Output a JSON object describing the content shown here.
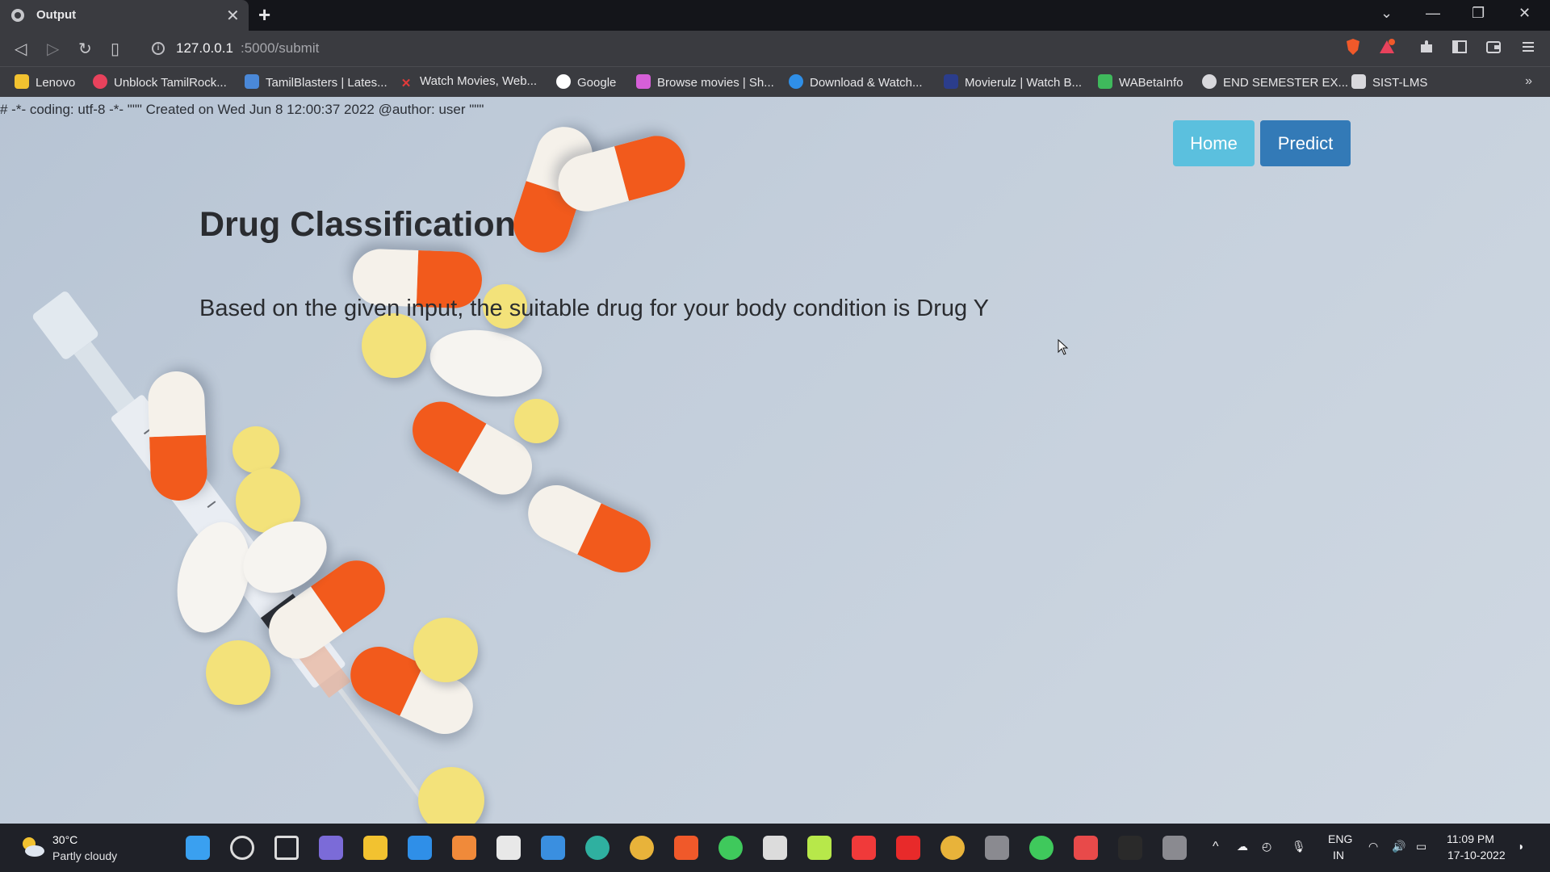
{
  "browser": {
    "tab_title": "Output",
    "tab_close": "✕",
    "new_tab": "+",
    "url_host": "127.0.0.1",
    "url_path": ":5000/submit",
    "window_controls": [
      "⌄",
      "—",
      "❐",
      "✕"
    ],
    "bookmarks": [
      {
        "label": "Lenovo",
        "icon": "folder-icon",
        "color": "#f2c230"
      },
      {
        "label": "Unblock TamilRock...",
        "icon": "tamilrockers-icon",
        "color": "#e8425c"
      },
      {
        "label": "TamilBlasters | Lates...",
        "icon": "tamilblasters-icon",
        "color": "#4a88d8"
      },
      {
        "label": "Watch Movies, Web...",
        "icon": "x-logo-icon",
        "color": "#e33a3a"
      },
      {
        "label": "Google",
        "icon": "google-icon",
        "color": "#ffffff"
      },
      {
        "label": "Browse movies | Sh...",
        "icon": "browse-movies-icon",
        "color": "#d65fd8"
      },
      {
        "label": "Download & Watch...",
        "icon": "play-icon",
        "color": "#2f8fe8"
      },
      {
        "label": "Movierulz | Watch B...",
        "icon": "movierulz-icon",
        "color": "#2b3d8c"
      },
      {
        "label": "WABetaInfo",
        "icon": "wabetainfo-icon",
        "color": "#3fb95c"
      },
      {
        "label": "END SEMESTER EX...",
        "icon": "globe-icon",
        "color": "#d8d8dc"
      },
      {
        "label": "SIST-LMS",
        "icon": "sist-lms-icon",
        "color": "#d8d8dc"
      }
    ],
    "bookmarks_more": "»"
  },
  "page": {
    "coding_comment": "# -*- coding: utf-8 -*- \"\"\" Created on Wed Jun 8 12:00:37 2022 @author: user \"\"\"",
    "nav_home": "Home",
    "nav_predict": "Predict",
    "heading": "Drug Classification",
    "result_text": "Based on the given input, the suitable drug for your body condition is Drug Y"
  },
  "taskbar": {
    "temperature": "30°C",
    "condition": "Partly cloudy",
    "language": "ENG",
    "region": "IN",
    "time": "11:09 PM",
    "date": "17-10-2022",
    "apps": [
      {
        "icon": "windows-start-icon",
        "color": "#3aa0f0"
      },
      {
        "icon": "search-icon",
        "color": "#dcdcdc"
      },
      {
        "icon": "task-view-icon",
        "color": "#dcdcdc"
      },
      {
        "icon": "teams-chat-icon",
        "color": "#7b6bd8"
      },
      {
        "icon": "file-explorer-icon",
        "color": "#f2c230"
      },
      {
        "icon": "desktop-icon",
        "color": "#2f8fe8"
      },
      {
        "icon": "media-player-icon",
        "color": "#f08a3a"
      },
      {
        "icon": "video-player-icon",
        "color": "#e8e8e8"
      },
      {
        "icon": "mail-icon",
        "color": "#3a8fe0"
      },
      {
        "icon": "edge-icon",
        "color": "#2fb0a0"
      },
      {
        "icon": "chrome-icon",
        "color": "#e8b33a"
      },
      {
        "icon": "brave-icon",
        "color": "#f0592a"
      },
      {
        "icon": "whatsapp-icon",
        "color": "#3fc95c"
      },
      {
        "icon": "notepad-icon",
        "color": "#dcdcdc"
      },
      {
        "icon": "pycharm-icon",
        "color": "#b7e84a"
      },
      {
        "icon": "youtube-icon",
        "color": "#f03a3a"
      },
      {
        "icon": "youtube-music-icon",
        "color": "#e82a2a"
      },
      {
        "icon": "chrome-profile-icon",
        "color": "#e8b33a"
      },
      {
        "icon": "terminal-icon",
        "color": "#8a8a90"
      },
      {
        "icon": "loader-icon",
        "color": "#3fc95c"
      },
      {
        "icon": "snipping-tool-icon",
        "color": "#e84a4a"
      },
      {
        "icon": "command-prompt-icon",
        "color": "#2a2a2a"
      },
      {
        "icon": "github-desktop-icon",
        "color": "#8a8a90"
      }
    ]
  }
}
